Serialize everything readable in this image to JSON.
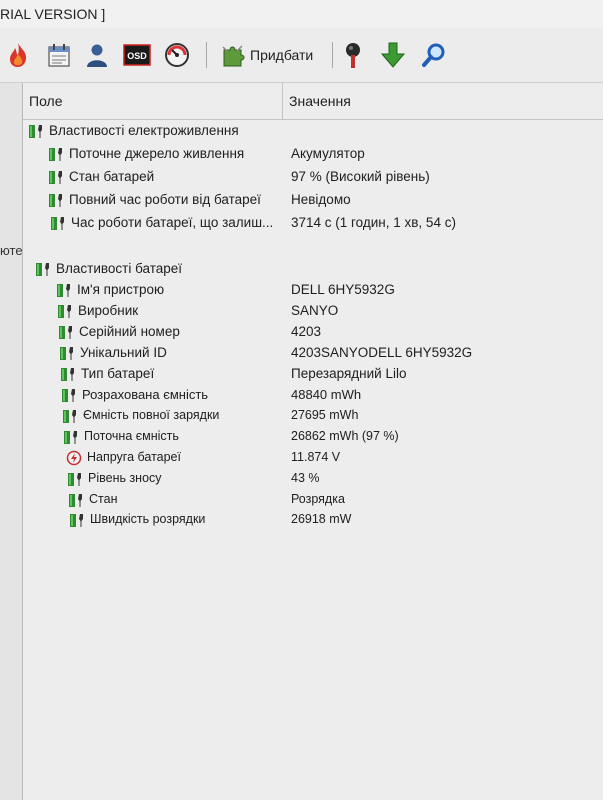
{
  "window": {
    "title": "RIAL VERSION ]"
  },
  "toolbar": {
    "buttons": [
      {
        "icon": "flame-icon"
      },
      {
        "icon": "calendar-icon"
      },
      {
        "icon": "user-icon"
      },
      {
        "icon": "osd-icon",
        "text": "OSD"
      },
      {
        "icon": "gauge-icon"
      },
      {
        "icon": "puzzle-icon",
        "label": "Придбати"
      },
      {
        "icon": "plug-icon"
      },
      {
        "icon": "down-arrow-icon"
      },
      {
        "icon": "search-icon"
      }
    ]
  },
  "left_pane": {
    "fragment": "ютe"
  },
  "table": {
    "columns": [
      "Поле",
      "Значення"
    ],
    "groups": [
      {
        "title": "Властивості електроживлення",
        "rows": [
          {
            "field": "Поточне джерело живлення",
            "value": "Акумулятор"
          },
          {
            "field": "Стан батарей",
            "value": "97 % (Високий рівень)"
          },
          {
            "field": "Повний час роботи від батареї",
            "value": "Невідомо"
          },
          {
            "field": "Час роботи батареї, що залиш...",
            "value": "3714 с (1 годин, 1 хв, 54 с)"
          }
        ]
      },
      {
        "title": "Властивості батареї",
        "rows": [
          {
            "field": "Ім'я пристрою",
            "value": "DELL 6HY5932G"
          },
          {
            "field": "Виробник",
            "value": "SANYO"
          },
          {
            "field": "Серійний номер",
            "value": "4203"
          },
          {
            "field": "Унікальний ID",
            "value": "4203SANYODELL 6HY5932G"
          },
          {
            "field": "Тип батареї",
            "value": "Перезарядний Lilo"
          },
          {
            "field": "Розрахована ємність",
            "value": "48840 mWh"
          },
          {
            "field": "Ємність повної зарядки",
            "value": "27695 mWh"
          },
          {
            "field": "Поточна ємність",
            "value": "26862 mWh  (97 %)"
          },
          {
            "field": "Напруга батареї",
            "value": "11.874 V"
          },
          {
            "field": "Рівень зносу",
            "value": "43 %"
          },
          {
            "field": "Стан",
            "value": "Розрядка"
          },
          {
            "field": "Швидкість розрядки",
            "value": "26918 mW"
          }
        ]
      }
    ]
  },
  "colors": {
    "battery_green": "#2f8a32",
    "battery_dark": "#1c5a1f",
    "accent_blue": "#2b6fc4"
  }
}
